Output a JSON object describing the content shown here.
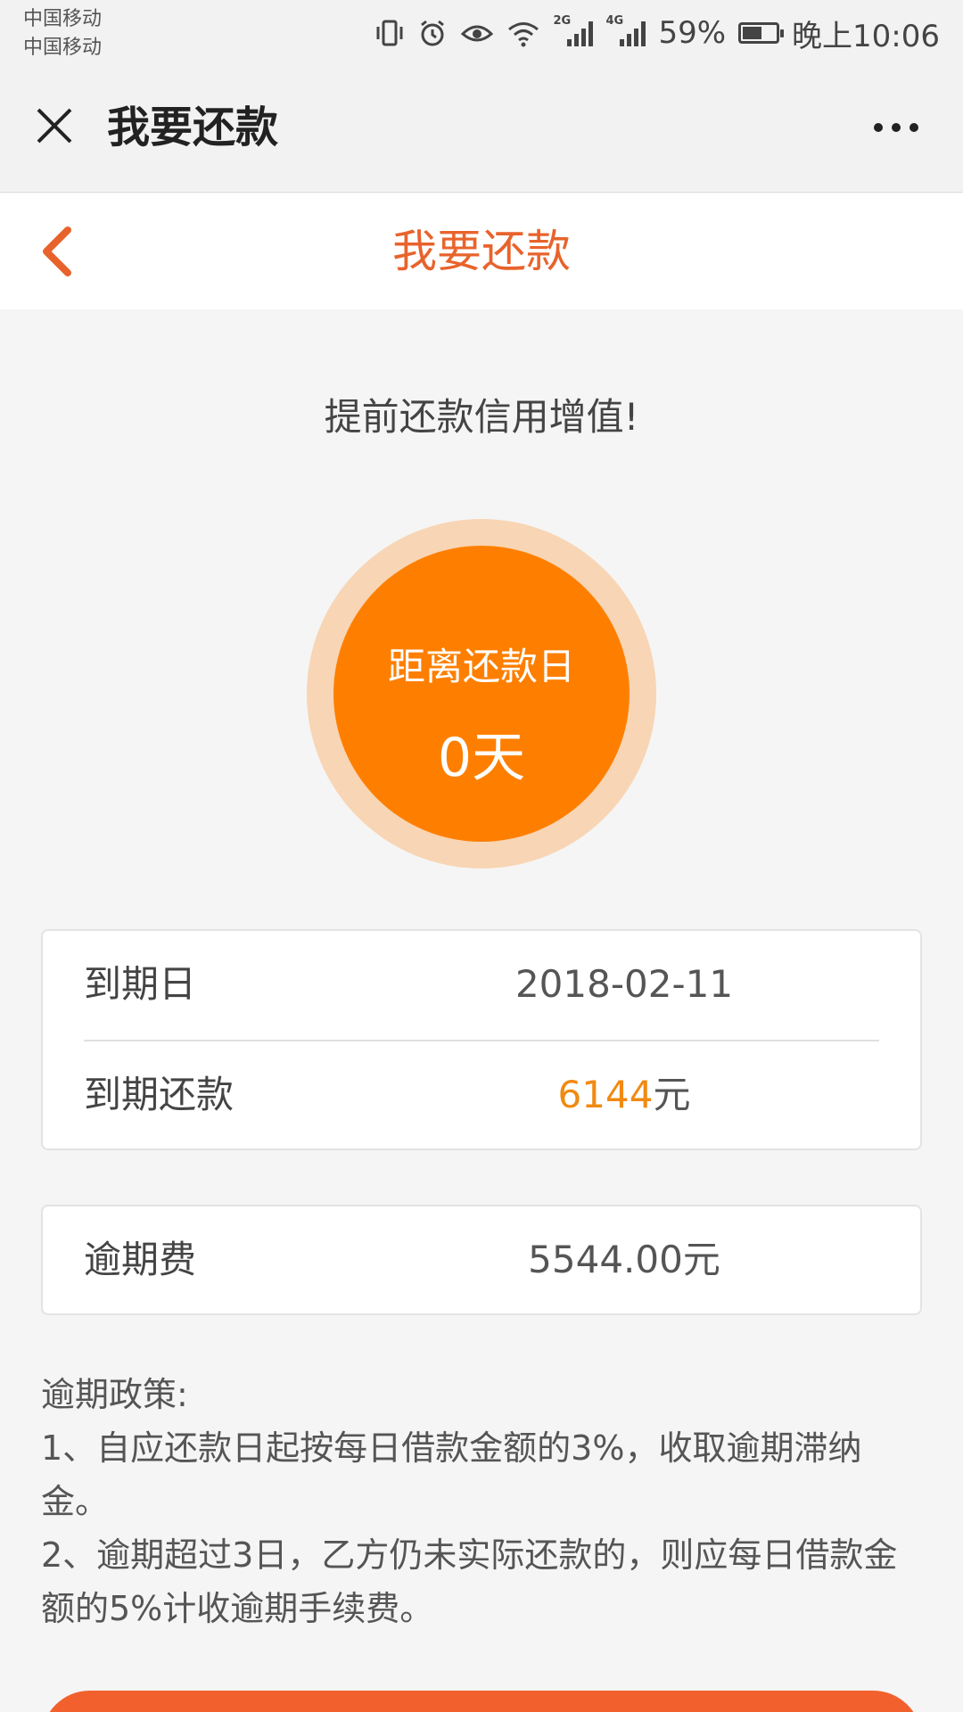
{
  "status_bar": {
    "carrier_1": "中国移动",
    "carrier_2": "中国移动",
    "network_1": "2G",
    "network_2": "4G",
    "battery_percent": "59%",
    "battery_level": 0.59,
    "time": "晚上10:06"
  },
  "top_nav": {
    "title": "我要还款"
  },
  "page_header": {
    "title": "我要还款"
  },
  "slogan": "提前还款信用增值!",
  "countdown": {
    "label": "距离还款日",
    "value": "0天"
  },
  "due_info": {
    "due_date_label": "到期日",
    "due_date_value": "2018-02-11",
    "due_amount_label": "到期还款",
    "due_amount_value": "6144",
    "due_amount_unit": "元"
  },
  "overdue_fee": {
    "label": "逾期费",
    "value": "5544.00元"
  },
  "policy": {
    "title": "逾期政策:",
    "item_1": "1、自应还款日起按每日借款金额的3%，收取逾期滞纳金。",
    "item_2": "2、逾期超过3日，乙方仍未实际还款的，则应每日借款金额的5%计收逾期手续费。"
  },
  "colors": {
    "accent": "#e8632c",
    "circle": "#fe7f00",
    "ring": "#f8d5b4",
    "amount": "#f08a12",
    "button": "#f2612d"
  },
  "icons": {
    "close": "close-icon",
    "more": "more-icon",
    "back": "back-chevron-icon",
    "vibrate": "vibrate-icon",
    "alarm": "alarm-icon",
    "eye": "eye-comfort-icon",
    "wifi": "wifi-icon",
    "signal": "signal-icon",
    "battery": "battery-icon"
  }
}
